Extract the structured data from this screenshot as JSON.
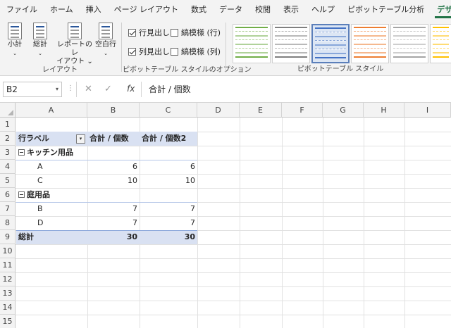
{
  "ribbon_tabs": [
    "ファイル",
    "ホーム",
    "挿入",
    "ページ レイアウト",
    "数式",
    "データ",
    "校閲",
    "表示",
    "ヘルプ",
    "ピボットテーブル分析",
    "デザイン"
  ],
  "ribbon": {
    "layout_group": {
      "label": "レイアウト",
      "subtotals": {
        "line1": "小計",
        "line2": "⌄"
      },
      "grand_totals": {
        "line1": "総計",
        "line2": "⌄"
      },
      "report_layout": {
        "line1": "レポートのレ",
        "line2": "イアウト ⌄"
      },
      "blank_rows": {
        "line1": "空白行",
        "line2": "⌄"
      }
    },
    "style_options_group": {
      "label": "ピボットテーブル スタイルのオプション",
      "row_headers": "行見出し",
      "col_headers": "列見出し",
      "banded_rows": "縞模様 (行)",
      "banded_cols": "縞模様 (列)"
    },
    "styles_group": {
      "label": "ピボットテーブル スタイル",
      "swatch_colors": [
        "#70ad47",
        "#7f7f7f",
        "#4472c4",
        "#ed7d31",
        "#a5a5a5",
        "#ffc000"
      ]
    }
  },
  "formula_bar": {
    "name_box": "B2",
    "name_box_caret": "▾",
    "dots": "⋮",
    "cancel": "✕",
    "confirm": "✓",
    "fx": "fx",
    "formula": "合計 / 個数"
  },
  "sheet": {
    "columns": [
      "A",
      "B",
      "C",
      "D",
      "E",
      "F",
      "G",
      "H",
      "I"
    ],
    "rows": [
      "1",
      "2",
      "3",
      "4",
      "5",
      "6",
      "7",
      "8",
      "9",
      "10",
      "11",
      "12",
      "13",
      "14",
      "15"
    ],
    "pivot": {
      "row_label_header": "行ラベル",
      "filter_caret": "▾",
      "sum_count_header": "合計 / 個数",
      "sum_count2_header": "合計 / 個数2",
      "group1": "キッチン用品",
      "a_label": "A",
      "a_b": "6",
      "a_c": "6",
      "c_label": "C",
      "c_b": "10",
      "c_c": "10",
      "group2": "庭用品",
      "b_label": "B",
      "b_b": "7",
      "b_c": "7",
      "d_label": "D",
      "d_b": "7",
      "d_c": "7",
      "grand_total": "総計",
      "gt_b": "30",
      "gt_c": "30"
    }
  }
}
